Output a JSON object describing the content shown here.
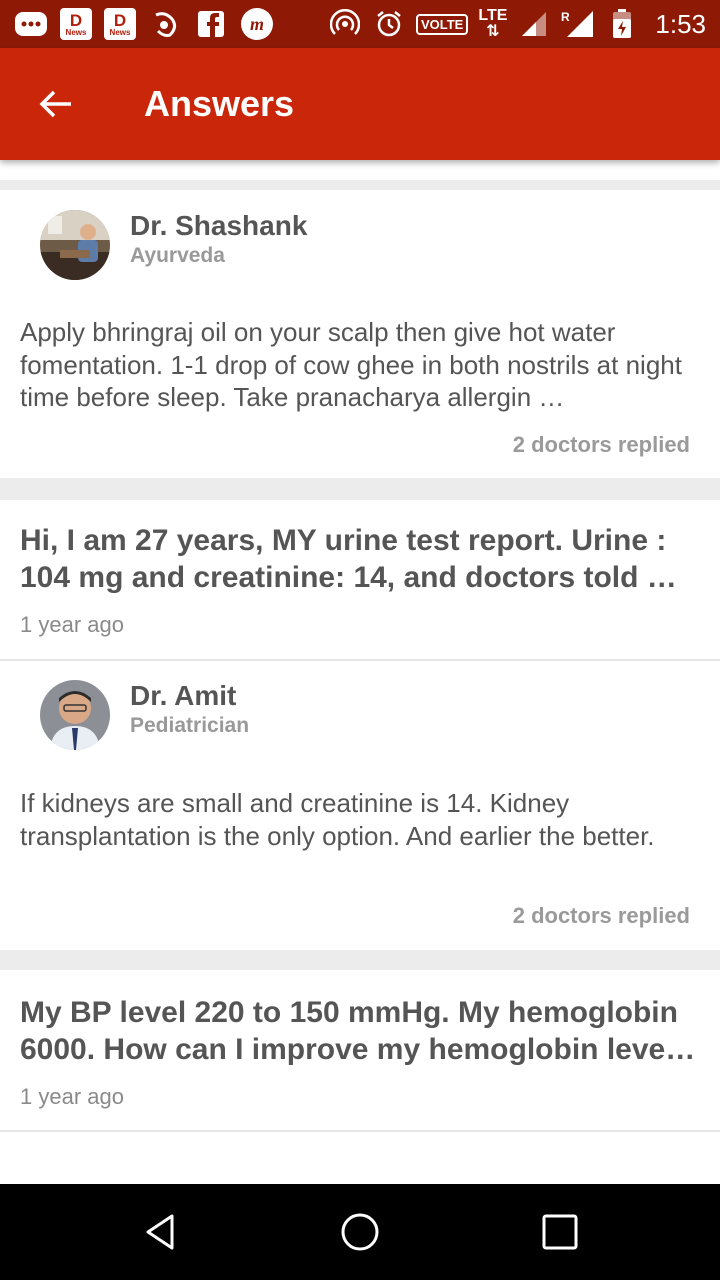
{
  "status_bar": {
    "news_label": "News",
    "network_volte": "VOLTE",
    "network_lte": "LTE",
    "roaming": "R",
    "time": "1:53"
  },
  "app_bar": {
    "title": "Answers"
  },
  "answers": [
    {
      "doctor_name": "Dr. Shashank",
      "specialty": "Ayurveda",
      "answer_text": "Apply bhringraj oil on your scalp then give hot water fomentation. 1-1 drop of cow ghee in both nostrils at night time before sleep. Take pranacharya allergin …",
      "replied": "2 doctors replied"
    },
    {
      "question": "Hi, I am 27 years, MY urine test report. Urine : 104 mg and creatinine: 14, and doctors told …",
      "time_ago": "1 year ago",
      "doctor_name": "Dr. Amit",
      "specialty": "Pediatrician",
      "answer_text": "If kidneys are small and creatinine is 14. Kidney transplantation is the only option. And earlier the better.",
      "replied": "2 doctors replied"
    },
    {
      "question": "My BP level 220 to 150 mmHg. My hemoglobin 6000. How can I improve my hemoglobin leve…",
      "time_ago": "1 year ago"
    }
  ],
  "colors": {
    "status_bar": "#8e1a06",
    "app_bar": "#c9260a",
    "text_primary": "#555555",
    "text_secondary": "#999999"
  }
}
